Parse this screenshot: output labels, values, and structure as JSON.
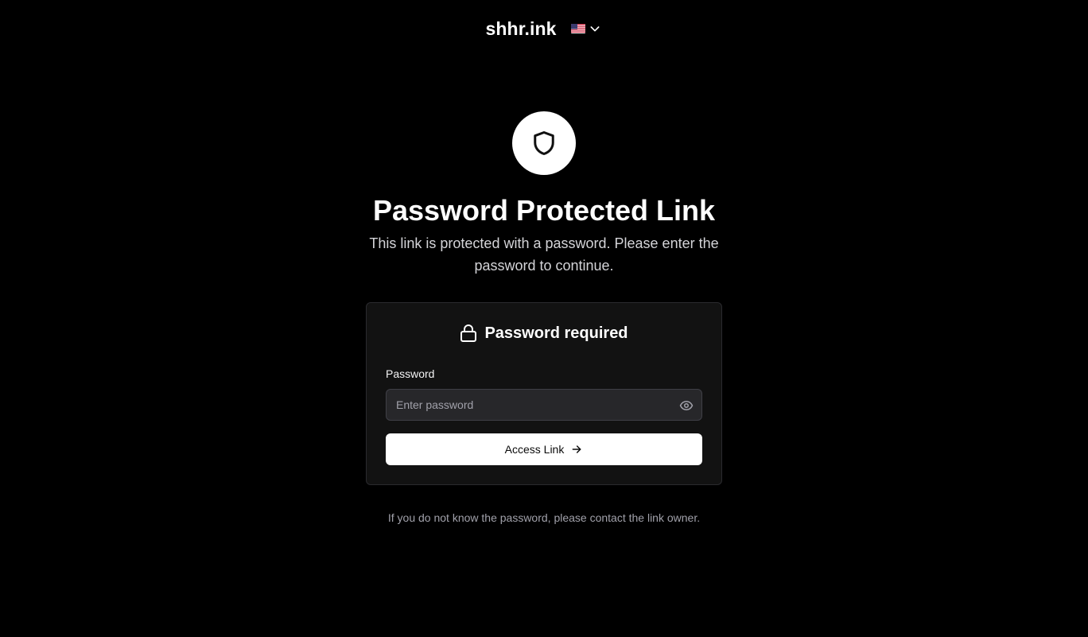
{
  "header": {
    "brand": "shhr.ink",
    "language_icon": "us-flag-icon",
    "dropdown_icon": "chevron-down-icon"
  },
  "hero": {
    "icon": "shield-icon",
    "title": "Password Protected Link",
    "subtitle": "This link is protected with a password. Please enter the password to continue."
  },
  "card": {
    "icon": "lock-icon",
    "title": "Password required",
    "password_label": "Password",
    "password_placeholder": "Enter password",
    "password_value": "",
    "toggle_icon": "eye-icon",
    "submit_label": "Access Link",
    "submit_icon": "arrow-right-icon"
  },
  "footer": {
    "note": "If you do not know the password, please contact the link owner."
  },
  "colors": {
    "background": "#000000",
    "card_bg": "#121212",
    "input_bg": "#27272a",
    "button_bg": "#ffffff",
    "muted_text": "#a1a1aa"
  }
}
